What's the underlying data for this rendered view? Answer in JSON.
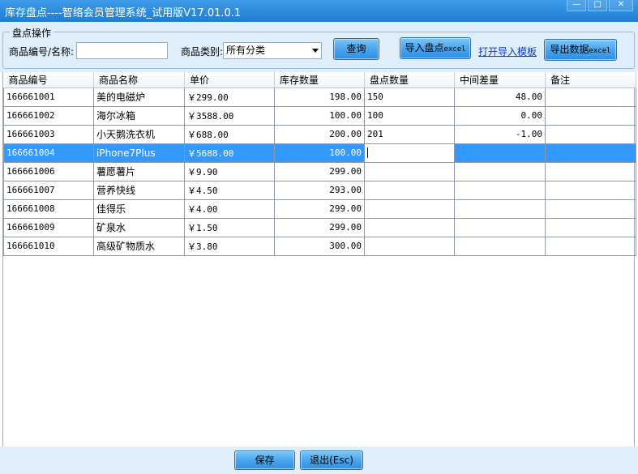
{
  "window": {
    "title": "库存盘点----智络会员管理系统_试用版V17.01.0.1",
    "minimize": "—",
    "maximize": "□",
    "close": "✕"
  },
  "toolbar": {
    "group_label": "盘点操作",
    "code_name_label": "商品编号/名称:",
    "code_name_value": "",
    "category_label": "商品类别:",
    "category_value": "所有分类",
    "query_button": "查询",
    "import_button": "导入盘点",
    "import_button_suffix": "excel",
    "template_link": "打开导入模板",
    "export_button": "导出数据",
    "export_button_suffix": "excel"
  },
  "table": {
    "columns": [
      "商品编号",
      "商品名称",
      "单价",
      "库存数量",
      "盘点数量",
      "中间差量",
      "备注"
    ],
    "rows": [
      {
        "code": "166661001",
        "name": "美的电磁炉",
        "price": "￥299.00",
        "stock": "198.00",
        "count": "150",
        "diff": "48.00",
        "note": ""
      },
      {
        "code": "166661002",
        "name": "海尔冰箱",
        "price": "￥3588.00",
        "stock": "100.00",
        "count": "100",
        "diff": "0.00",
        "note": ""
      },
      {
        "code": "166661003",
        "name": "小天鹅洗衣机",
        "price": "￥688.00",
        "stock": "200.00",
        "count": "201",
        "diff": "-1.00",
        "note": ""
      },
      {
        "code": "166661004",
        "name": "iPhone7Plus",
        "price": "￥5688.00",
        "stock": "100.00",
        "count": "",
        "diff": "",
        "note": ""
      },
      {
        "code": "166661006",
        "name": "薯愿薯片",
        "price": "￥9.90",
        "stock": "299.00",
        "count": "",
        "diff": "",
        "note": ""
      },
      {
        "code": "166661007",
        "name": "营养快线",
        "price": "￥4.50",
        "stock": "293.00",
        "count": "",
        "diff": "",
        "note": ""
      },
      {
        "code": "166661008",
        "name": "佳得乐",
        "price": "￥4.00",
        "stock": "299.00",
        "count": "",
        "diff": "",
        "note": ""
      },
      {
        "code": "166661009",
        "name": "矿泉水",
        "price": "￥1.50",
        "stock": "299.00",
        "count": "",
        "diff": "",
        "note": ""
      },
      {
        "code": "166661010",
        "name": "高级矿物质水",
        "price": "￥3.80",
        "stock": "300.00",
        "count": "",
        "diff": "",
        "note": ""
      }
    ],
    "selected_row": 3
  },
  "footer": {
    "save_button": "保存",
    "exit_button": "退出(Esc)"
  },
  "colors": {
    "titlebar": "#1f7ed4",
    "selection": "#3399ff",
    "panel": "#dfeefb",
    "link": "#0b38c9"
  }
}
